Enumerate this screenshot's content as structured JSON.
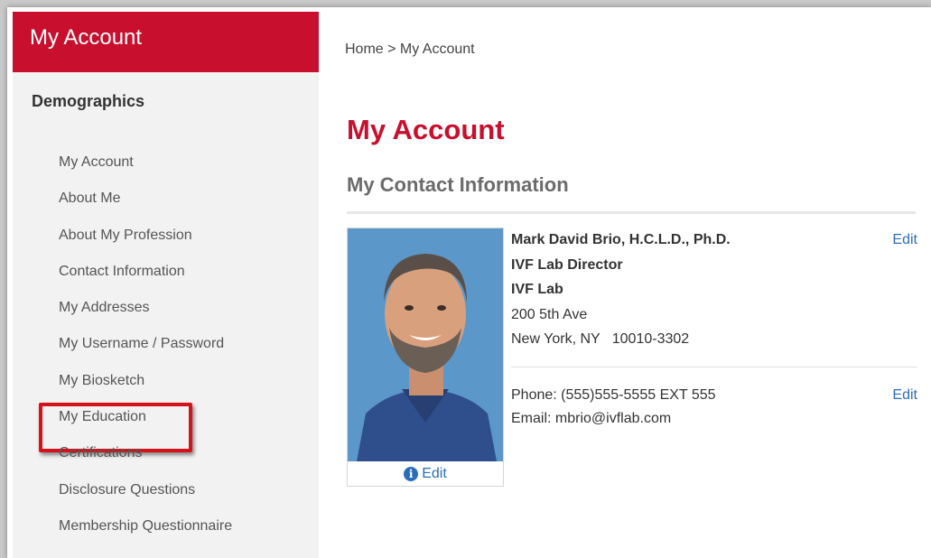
{
  "sidebar": {
    "header": "My Account",
    "section": "Demographics",
    "items": [
      {
        "label": "My Account"
      },
      {
        "label": "About Me"
      },
      {
        "label": "About My Profession"
      },
      {
        "label": "Contact Information"
      },
      {
        "label": "My Addresses"
      },
      {
        "label": "My Username / Password"
      },
      {
        "label": "My Biosketch"
      },
      {
        "label": "My Education"
      },
      {
        "label": "Certifications"
      },
      {
        "label": "Disclosure Questions"
      },
      {
        "label": "Membership Questionnaire"
      }
    ]
  },
  "breadcrumb": "Home > My Account",
  "page_title": "My Account",
  "section_title": "My Contact Information",
  "photo_edit_label": "Edit",
  "contact": {
    "name": "Mark David Brio, H.C.L.D., Ph.D.",
    "title": "IVF Lab Director",
    "organization": "IVF Lab",
    "address1": "200 5th Ave",
    "city_line": "New York, NY   10010-3302",
    "edit_label": "Edit",
    "phone": "Phone: (555)555-5555 EXT 555",
    "email": "Email: mbrio@ivflab.com",
    "edit2_label": "Edit"
  },
  "colors": {
    "brand_red": "#c8102e",
    "link_blue": "#2a6ebb",
    "highlight_red": "#d3121b"
  }
}
